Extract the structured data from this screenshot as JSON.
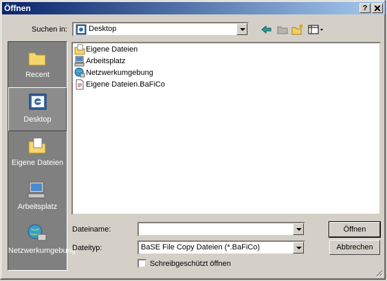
{
  "window": {
    "title": "Öffnen",
    "help_btn": "?",
    "close_btn": "✕"
  },
  "lookin": {
    "label": "Suchen in:",
    "value": "Desktop"
  },
  "toolbar_icons": [
    "back-arrow-icon",
    "up-folder-icon",
    "new-folder-icon",
    "view-menu-icon"
  ],
  "places": [
    {
      "label": "Recent",
      "icon": "recent-folder-icon"
    },
    {
      "label": "Desktop",
      "icon": "desktop-icon"
    },
    {
      "label": "Eigene Dateien",
      "icon": "my-documents-icon"
    },
    {
      "label": "Arbeitsplatz",
      "icon": "my-computer-icon"
    },
    {
      "label": "Netzwerkumgebung",
      "icon": "network-icon"
    }
  ],
  "files": [
    {
      "name": "Eigene Dateien",
      "icon": "my-documents-icon"
    },
    {
      "name": "Arbeitsplatz",
      "icon": "my-computer-icon"
    },
    {
      "name": "Netzwerkumgebung",
      "icon": "network-icon"
    },
    {
      "name": "Eigene Dateien.BaFiCo",
      "icon": "file-icon"
    }
  ],
  "filename": {
    "label": "Dateiname:",
    "value": ""
  },
  "filetype": {
    "label": "Dateityp:",
    "value": "BaSE File Copy Dateien (*.BaFiCo)"
  },
  "readonly": {
    "label": "Schreibgeschützt öffnen",
    "checked": false
  },
  "buttons": {
    "open": "Öffnen",
    "cancel": "Abbrechen"
  }
}
